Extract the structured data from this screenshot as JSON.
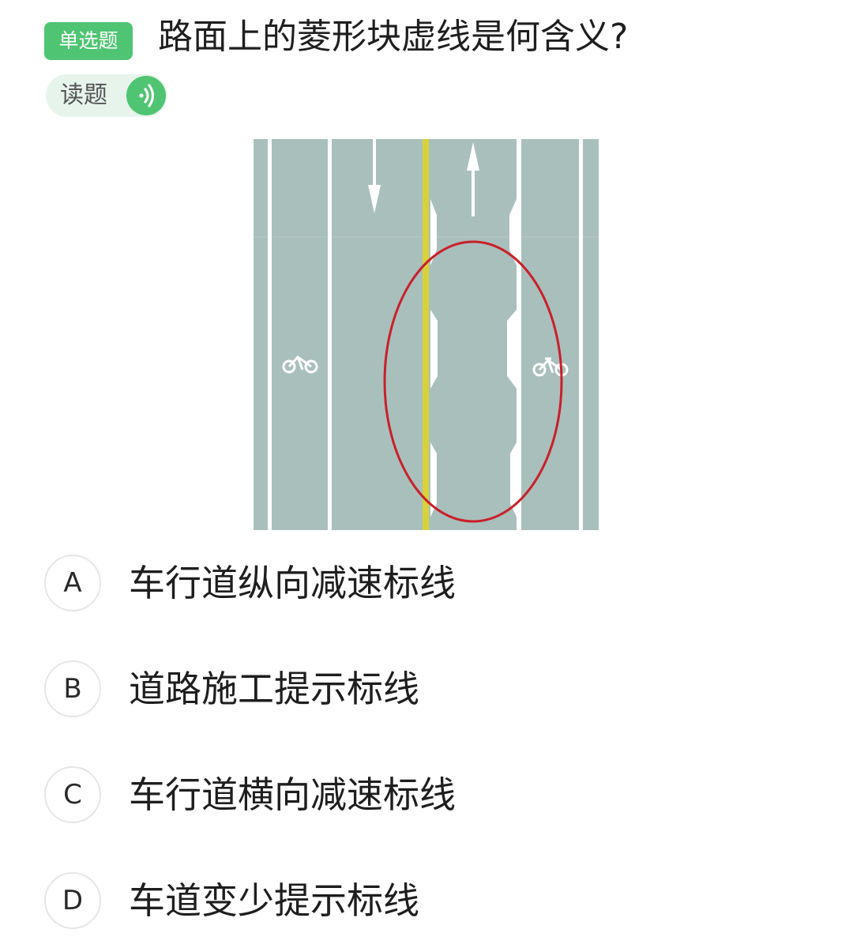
{
  "question": {
    "type_badge": "单选题",
    "text": "路面上的菱形块虚线是何含义?"
  },
  "read_button": {
    "label": "读题",
    "icon": "sound-wave-icon"
  },
  "colors": {
    "accent_green": "#4fc472",
    "road_surface": "#a9bfbc",
    "center_line_yellow": "#d7d23a",
    "highlight_circle_red": "#c8202a"
  },
  "options": [
    {
      "letter": "A",
      "text": "车行道纵向减速标线"
    },
    {
      "letter": "B",
      "text": "道路施工提示标线"
    },
    {
      "letter": "C",
      "text": "车行道横向减速标线"
    },
    {
      "letter": "D",
      "text": "车道变少提示标线"
    }
  ]
}
